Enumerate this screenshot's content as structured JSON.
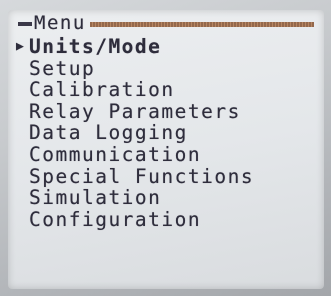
{
  "menu": {
    "title": "Menu",
    "cursor": "▶",
    "selected_index": 0,
    "items": [
      {
        "label": "Units/Mode"
      },
      {
        "label": "Setup"
      },
      {
        "label": "Calibration"
      },
      {
        "label": "Relay Parameters"
      },
      {
        "label": "Data Logging"
      },
      {
        "label": "Communication"
      },
      {
        "label": "Special Functions"
      },
      {
        "label": "Simulation"
      },
      {
        "label": "Configuration"
      }
    ]
  },
  "colors": {
    "lcd_background": "#e4e7ea",
    "lcd_text": "#2e2d3c",
    "header_rule": "#8b5a3a"
  }
}
